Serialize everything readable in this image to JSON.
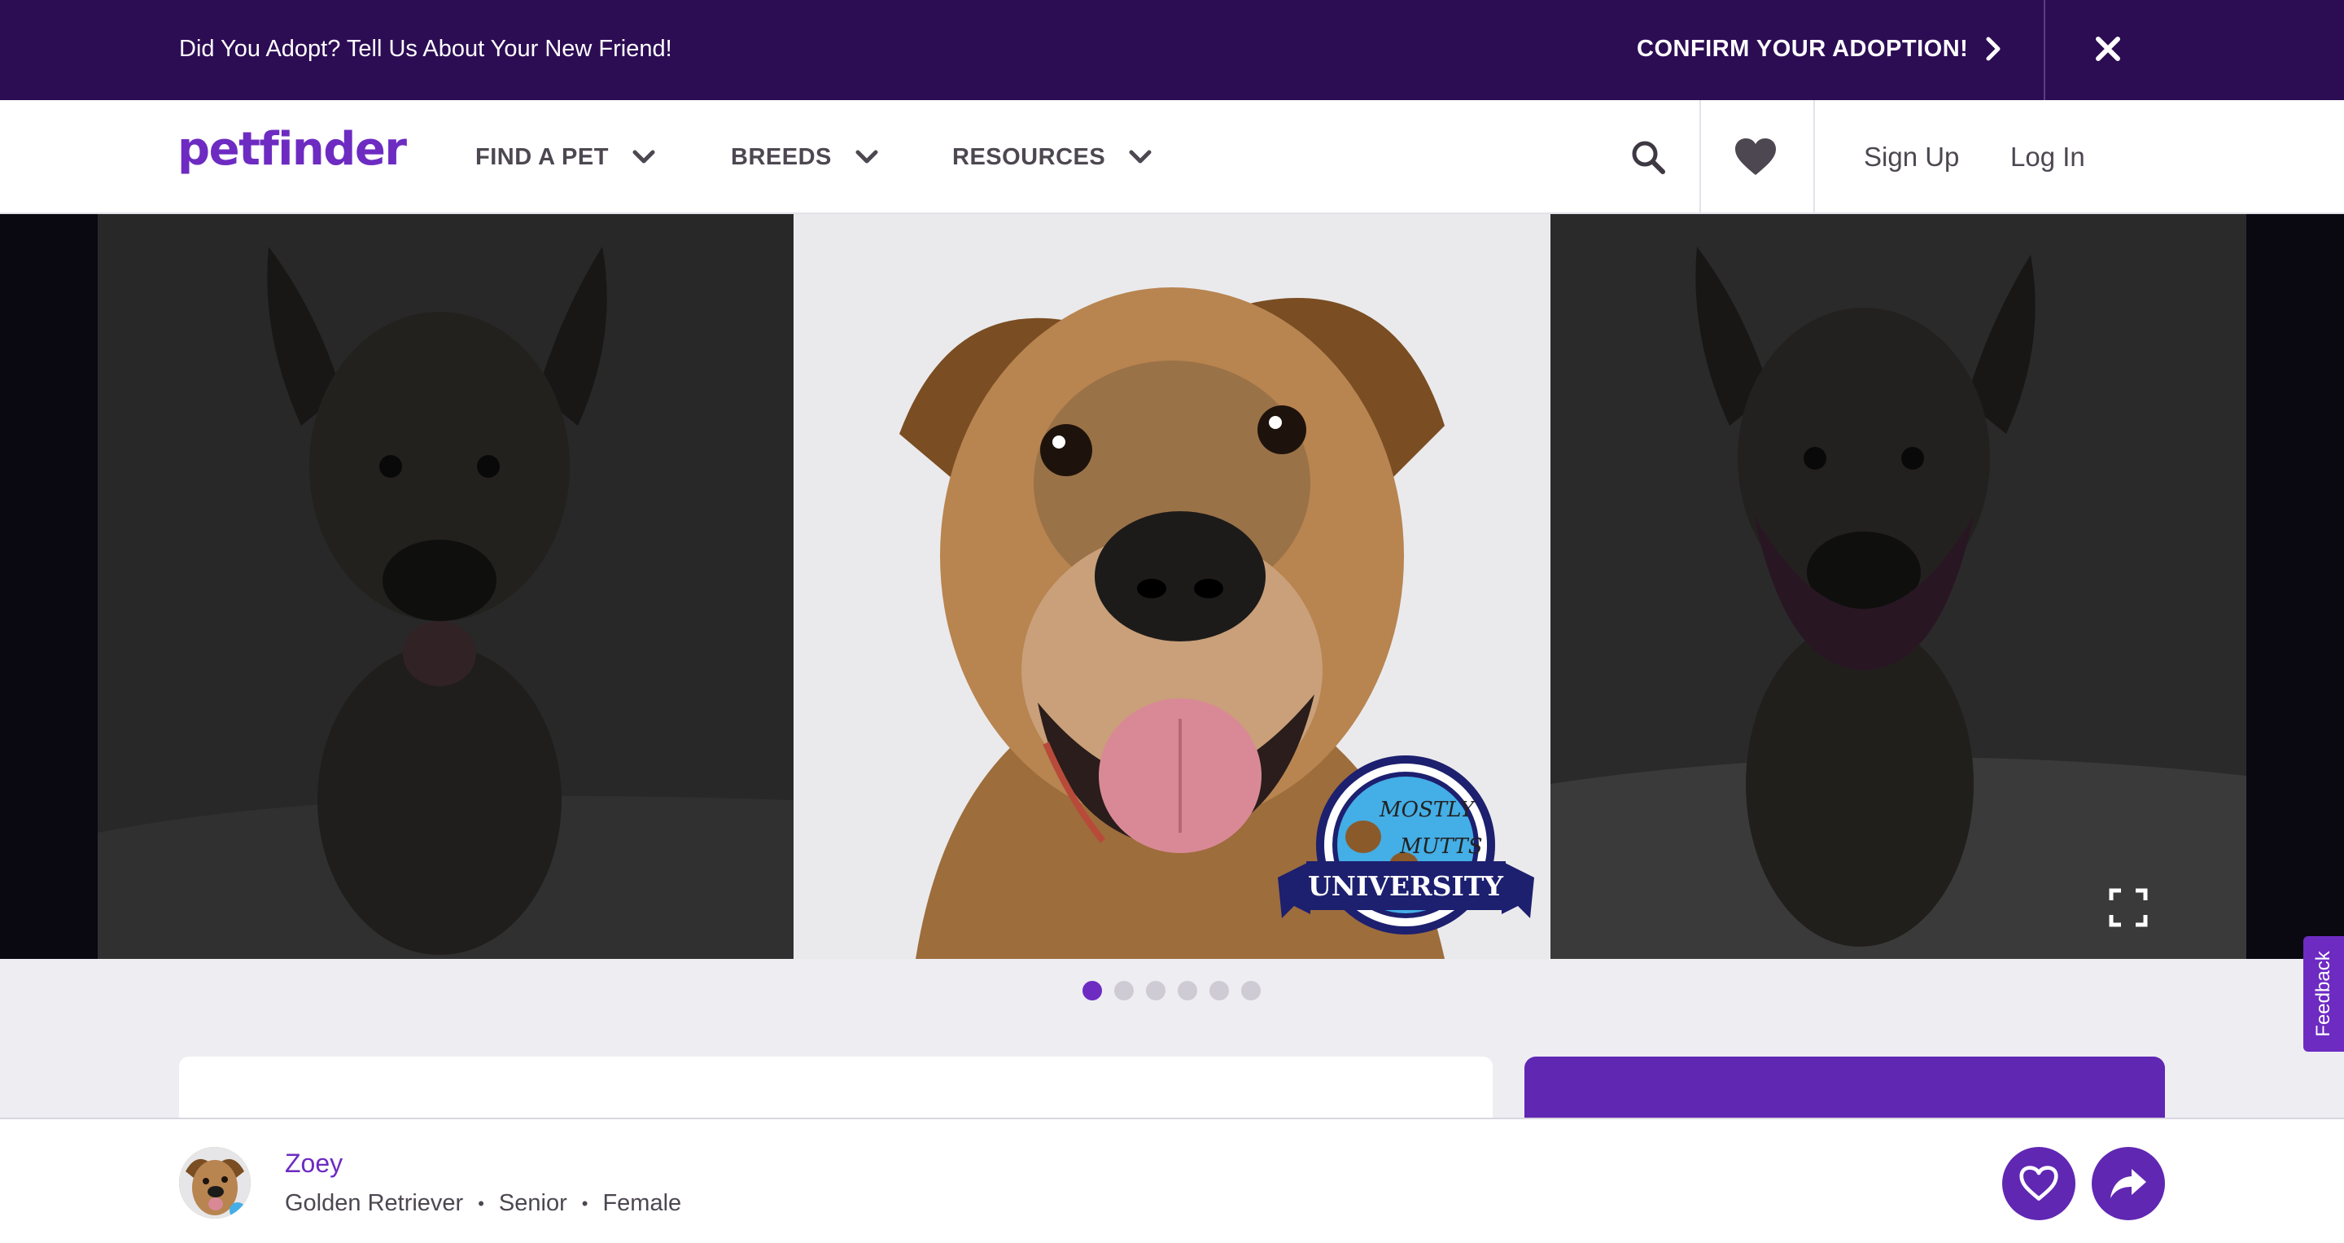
{
  "promo": {
    "text": "Did You Adopt? Tell Us About Your New Friend!",
    "cta_label": "CONFIRM YOUR ADOPTION!",
    "close_icon": "close-icon"
  },
  "header": {
    "logo": "petfinder",
    "nav": [
      {
        "label": "FIND A PET"
      },
      {
        "label": "BREEDS"
      },
      {
        "label": "RESOURCES"
      }
    ],
    "sign_up": "Sign Up",
    "log_in": "Log In"
  },
  "gallery": {
    "badge": {
      "top": "MOSTLY MUTTS",
      "banner": "UNIVERSITY"
    },
    "dots_total": 6,
    "active_dot": 1
  },
  "feedback": {
    "label": "Feedback"
  },
  "pet": {
    "name": "Zoey",
    "breed": "Golden Retriever",
    "age": "Senior",
    "gender": "Female",
    "separator": "•"
  },
  "colors": {
    "brand_purple": "#6d2bc2",
    "banner_dark": "#2c0d54",
    "button_purple": "#6027b3"
  }
}
